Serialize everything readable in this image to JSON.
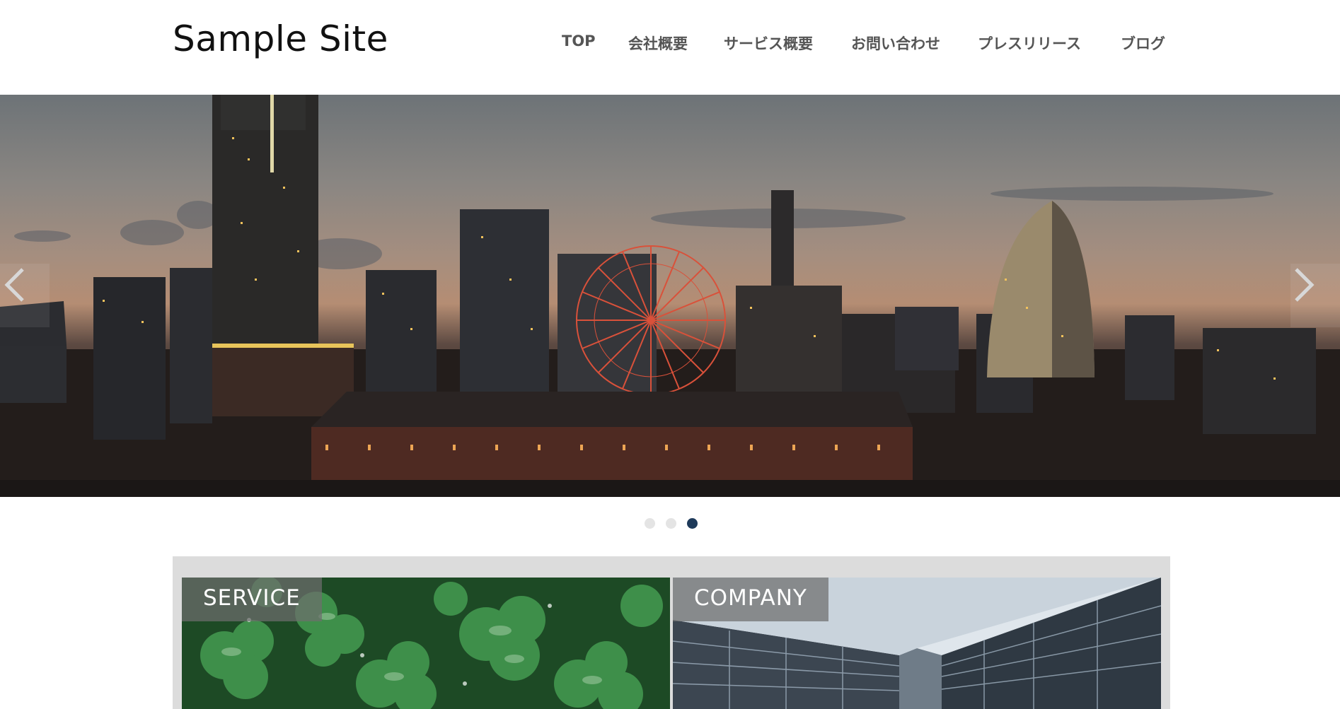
{
  "site": {
    "title": "Sample Site"
  },
  "nav": {
    "items": [
      {
        "label": "TOP"
      },
      {
        "label": "会社概要"
      },
      {
        "label": "サービス概要"
      },
      {
        "label": "お問い合わせ"
      },
      {
        "label": "プレスリリース"
      },
      {
        "label": "ブログ"
      }
    ]
  },
  "hero": {
    "prev_icon": "chevron-left-icon",
    "next_icon": "chevron-right-icon",
    "slide_count": 3,
    "active_slide": 3,
    "active_dot_color": "#1e3a5a",
    "inactive_dot_color": "#e4e4e4"
  },
  "features": {
    "service": {
      "label": "SERVICE"
    },
    "company": {
      "label": "COMPANY"
    }
  }
}
